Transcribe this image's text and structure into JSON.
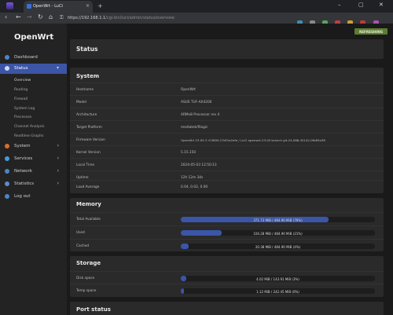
{
  "browser": {
    "tab_title": "OpenWrt - LuCI",
    "tab_close": "×",
    "new_tab": "+",
    "win_min": "–",
    "win_max": "▢",
    "win_close": "✕",
    "url_host": "https://192.168.1.1",
    "url_path": "/cgi-bin/luci/admin/status/overview"
  },
  "sidebar": {
    "brand": "OpenWrt",
    "items": [
      {
        "label": "Dashboard"
      },
      {
        "label": "Status"
      },
      {
        "label": "System"
      },
      {
        "label": "Services"
      },
      {
        "label": "Network"
      },
      {
        "label": "Statistics"
      },
      {
        "label": "Log out"
      }
    ],
    "status_sub": [
      "Overview",
      "Routing",
      "Firewall",
      "System Log",
      "Processes",
      "Channel Analysis",
      "Realtime Graphs"
    ]
  },
  "header": {
    "refresh_label": "REFRESHING",
    "page_title": "Status"
  },
  "system": {
    "title": "System",
    "rows": [
      {
        "k": "Hostname",
        "v": "OpenWrt"
      },
      {
        "k": "Model",
        "v": "ASUS TUF-AX4200"
      },
      {
        "k": "Architecture",
        "v": "ARMv8 Processor rev 4"
      },
      {
        "k": "Target Platform",
        "v": "mediatek/filogic"
      },
      {
        "k": "Firmware Version",
        "v": "OpenWrt 23.05.3 r23809-234f1a2efa / LuCI openwrt-23.05 branch git-24.086.45142-0fb85a38"
      },
      {
        "k": "Kernel Version",
        "v": "5.15.150"
      },
      {
        "k": "Local Time",
        "v": "2024-05-03 12:50:13"
      },
      {
        "k": "Uptime",
        "v": "12h 12m 34s"
      },
      {
        "k": "Load Average",
        "v": "0.04, 0.02, 0.00"
      }
    ]
  },
  "memory": {
    "title": "Memory",
    "rows": [
      {
        "k": "Total Available",
        "v": "371.73 MiB / 484.90 MiB (76%)",
        "pct": 76
      },
      {
        "k": "Used",
        "v": "104.28 MiB / 484.90 MiB (21%)",
        "pct": 21
      },
      {
        "k": "Cached",
        "v": "20.38 MiB / 484.90 MiB (4%)",
        "pct": 4
      }
    ]
  },
  "storage": {
    "title": "Storage",
    "rows": [
      {
        "k": "Disk space",
        "v": "4.02 MiB / 143.91 MiB (3%)",
        "pct": 3
      },
      {
        "k": "Temp space",
        "v": "1.12 MiB / 242.45 MiB (0%)",
        "pct": 0
      }
    ]
  },
  "port_status": {
    "title": "Port status"
  },
  "colors": {
    "accent": "#3c55a6",
    "refresh": "#5c7c33",
    "bar": "#3b55a8"
  }
}
